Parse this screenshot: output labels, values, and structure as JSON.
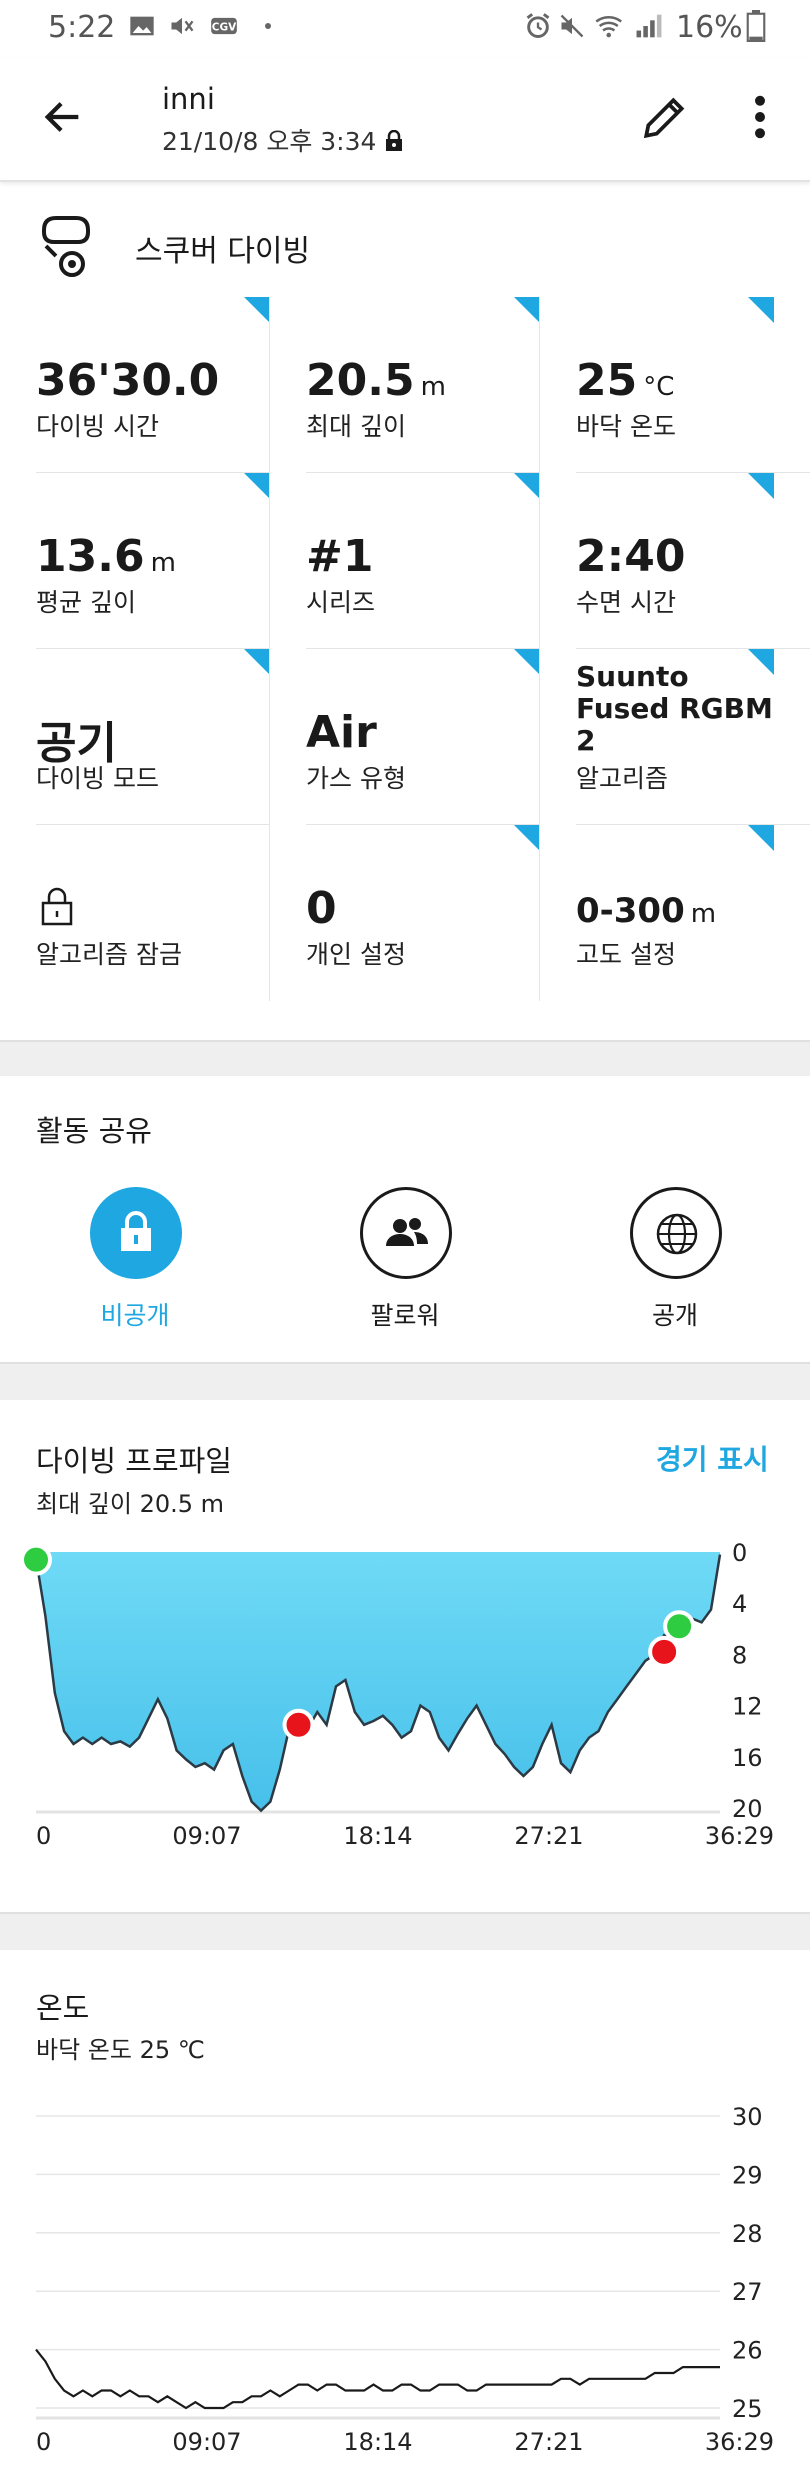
{
  "status_bar": {
    "time": "5:22",
    "battery": "16%"
  },
  "header": {
    "title": "inni",
    "datetime": "21/10/8 오후 3:34"
  },
  "activity": {
    "type": "스쿠버 다이빙"
  },
  "stats": [
    {
      "value": "36'30.0",
      "unit": "",
      "label": "다이빙 시간"
    },
    {
      "value": "20.5",
      "unit": "m",
      "label": "최대 깊이"
    },
    {
      "value": "25",
      "unit": "°C",
      "label": "바닥 온도"
    },
    {
      "value": "13.6",
      "unit": "m",
      "label": "평균 깊이"
    },
    {
      "value": "#1",
      "unit": "",
      "label": "시리즈"
    },
    {
      "value": "2:40",
      "unit": "",
      "label": "수면 시간"
    },
    {
      "value": "공기",
      "unit": "",
      "label": "다이빙 모드"
    },
    {
      "value": "Air",
      "unit": "",
      "label": "가스 유형"
    },
    {
      "value": "Suunto Fused RGBM 2",
      "unit": "",
      "label": "알고리즘"
    },
    {
      "value": "",
      "unit": "",
      "label": "알고리즘 잠금"
    },
    {
      "value": "0",
      "unit": "",
      "label": "개인 설정"
    },
    {
      "value": "0-300",
      "unit": "m",
      "label": "고도 설정"
    }
  ],
  "sharing": {
    "title": "활동 공유",
    "options": [
      {
        "label": "비공개",
        "icon": "lock-icon",
        "selected": true
      },
      {
        "label": "팔로워",
        "icon": "followers-icon",
        "selected": false
      },
      {
        "label": "공개",
        "icon": "globe-icon",
        "selected": false
      }
    ]
  },
  "colors": {
    "accent": "#1ea7e0",
    "depth_fill": "#5ccff0",
    "marker_green": "#2ecc40",
    "marker_red": "#e8141b"
  },
  "profile": {
    "title": "다이빙 프로파일",
    "subtitle": "최대 깊이 20.5 m",
    "link": "경기 표시"
  },
  "temperature": {
    "title": "온도",
    "subtitle": "바닥 온도 25 ℃"
  },
  "chart_data": [
    {
      "type": "area",
      "x_tick_labels": [
        "0",
        "09:07",
        "18:14",
        "27:21",
        "36:29"
      ],
      "y_tick_labels": [
        "0",
        "4",
        "8",
        "12",
        "16",
        "20"
      ],
      "ylim": [
        20,
        0
      ],
      "xlim_min": [
        0,
        36.48
      ],
      "x": [
        0,
        0.5,
        1,
        1.5,
        2,
        2.5,
        3,
        3.5,
        4,
        4.5,
        5,
        5.5,
        6,
        6.5,
        7,
        7.5,
        8,
        8.5,
        9,
        9.5,
        10,
        10.5,
        11,
        11.5,
        12,
        12.5,
        13,
        13.5,
        14,
        14.5,
        15,
        15.5,
        16,
        16.5,
        17,
        17.5,
        18,
        18.5,
        19,
        19.5,
        20,
        20.5,
        21,
        21.5,
        22,
        22.5,
        23,
        23.5,
        24,
        24.5,
        25,
        25.5,
        26,
        26.5,
        27,
        27.5,
        28,
        28.5,
        29,
        29.5,
        30,
        30.5,
        31,
        31.5,
        32,
        32.5,
        33,
        33.5,
        34,
        34.5,
        35,
        35.5,
        36,
        36.48
      ],
      "depth": [
        0.5,
        5,
        11,
        14,
        15,
        14.5,
        15,
        14.5,
        15,
        14.8,
        15.2,
        14.5,
        13,
        11.5,
        13,
        15.5,
        16.2,
        16.8,
        16.5,
        17,
        15.5,
        15,
        17.5,
        19.5,
        20.2,
        19.5,
        17,
        13.8,
        13.5,
        13.8,
        12.5,
        13.5,
        10.5,
        10,
        12.5,
        13.5,
        13.2,
        12.8,
        13.5,
        14.5,
        14,
        12,
        12.5,
        14.5,
        15.5,
        14.2,
        13,
        12,
        13.5,
        15,
        15.8,
        16.8,
        17.5,
        16.8,
        15,
        13.5,
        16.5,
        17.2,
        15.5,
        14.5,
        14,
        12.5,
        11.5,
        10.5,
        9.5,
        8.5,
        8,
        6.5,
        6.8,
        6,
        5.2,
        5.5,
        4.5,
        0.2
      ],
      "markers": [
        {
          "x": 0,
          "depth": 0.6,
          "color": "green"
        },
        {
          "x": 14,
          "depth": 13.5,
          "color": "red"
        },
        {
          "x": 33.5,
          "depth": 7.8,
          "color": "red"
        },
        {
          "x": 34.3,
          "depth": 5.8,
          "color": "green"
        }
      ]
    },
    {
      "type": "line",
      "x_tick_labels": [
        "0",
        "09:07",
        "18:14",
        "27:21",
        "36:29"
      ],
      "y_tick_labels": [
        "30",
        "29",
        "28",
        "27",
        "26",
        "25"
      ],
      "ylim": [
        25,
        30
      ],
      "xlim_min": [
        0,
        36.48
      ],
      "x": [
        0,
        0.5,
        1,
        1.5,
        2,
        2.5,
        3,
        3.5,
        4,
        4.5,
        5,
        5.5,
        6,
        6.5,
        7,
        7.5,
        8,
        8.5,
        9,
        9.5,
        10,
        10.5,
        11,
        11.5,
        12,
        12.5,
        13,
        13.5,
        14,
        14.5,
        15,
        15.5,
        16,
        16.5,
        17,
        17.5,
        18,
        18.5,
        19,
        19.5,
        20,
        20.5,
        21,
        21.5,
        22,
        22.5,
        23,
        23.5,
        24,
        24.5,
        25,
        25.5,
        26,
        26.5,
        27,
        27.5,
        28,
        28.5,
        29,
        29.5,
        30,
        30.5,
        31,
        31.5,
        32,
        32.5,
        33,
        33.5,
        34,
        34.5,
        35,
        35.5,
        36,
        36.48
      ],
      "temp": [
        26,
        25.8,
        25.5,
        25.3,
        25.2,
        25.3,
        25.2,
        25.3,
        25.3,
        25.2,
        25.3,
        25.2,
        25.2,
        25.1,
        25.2,
        25.1,
        25.0,
        25.1,
        25.0,
        25.0,
        25.0,
        25.1,
        25.1,
        25.2,
        25.2,
        25.3,
        25.2,
        25.3,
        25.4,
        25.4,
        25.3,
        25.4,
        25.4,
        25.3,
        25.3,
        25.3,
        25.4,
        25.3,
        25.3,
        25.4,
        25.4,
        25.3,
        25.3,
        25.4,
        25.4,
        25.4,
        25.3,
        25.3,
        25.4,
        25.4,
        25.4,
        25.4,
        25.4,
        25.4,
        25.4,
        25.4,
        25.5,
        25.5,
        25.4,
        25.5,
        25.5,
        25.5,
        25.5,
        25.5,
        25.5,
        25.5,
        25.6,
        25.6,
        25.6,
        25.7,
        25.7,
        25.7,
        25.7,
        25.7
      ]
    }
  ]
}
